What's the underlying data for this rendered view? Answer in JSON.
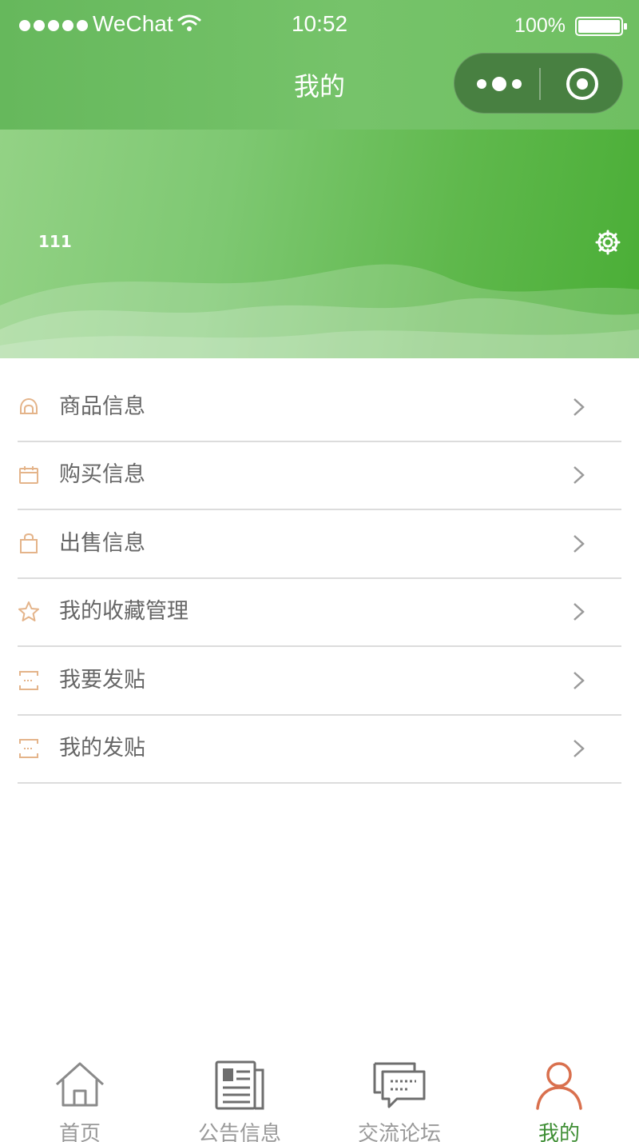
{
  "status_bar": {
    "carrier": "WeChat",
    "time": "10:52",
    "battery": "100%"
  },
  "nav": {
    "title": "我的"
  },
  "profile": {
    "username": "111"
  },
  "menu": {
    "items": [
      {
        "label": "商品信息",
        "icon": "goods-icon"
      },
      {
        "label": "购买信息",
        "icon": "calendar-icon"
      },
      {
        "label": "出售信息",
        "icon": "shopping-bag-icon"
      },
      {
        "label": "我的收藏管理",
        "icon": "star-icon"
      },
      {
        "label": "我要发贴",
        "icon": "post-icon"
      },
      {
        "label": "我的发贴",
        "icon": "post-icon"
      }
    ]
  },
  "tabbar": {
    "items": [
      {
        "label": "首页",
        "icon": "home-icon",
        "active": false
      },
      {
        "label": "公告信息",
        "icon": "news-icon",
        "active": false
      },
      {
        "label": "交流论坛",
        "icon": "forum-icon",
        "active": false
      },
      {
        "label": "我的",
        "icon": "person-icon",
        "active": true
      }
    ]
  },
  "colors": {
    "accent": "#6bbd5f",
    "menu_icon": "#e4b48a",
    "active_tab": "#3e8e34",
    "active_tab_icon": "#d9704e"
  }
}
